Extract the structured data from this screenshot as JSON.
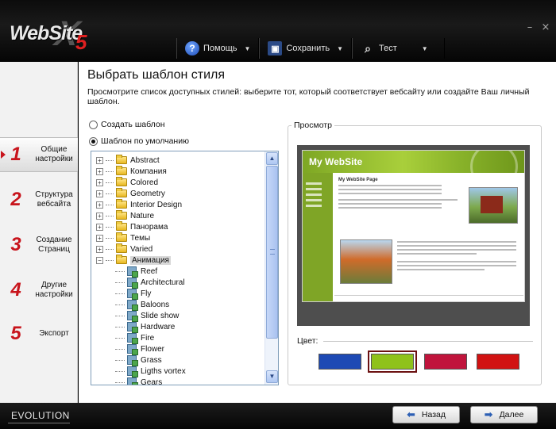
{
  "app": {
    "logo_text": "WebSite",
    "logo_x": "X",
    "logo_version": "5",
    "window_controls": [
      "–",
      "×"
    ]
  },
  "toolbar": {
    "help_label": "Помощь",
    "save_label": "Сохранить",
    "test_label": "Тест",
    "help_icon": "help-icon",
    "save_icon": "floppy-icon",
    "test_icon": "magnifier-icon"
  },
  "sidebar": {
    "items": [
      {
        "num": "1",
        "label": "Общие настройки",
        "active": true
      },
      {
        "num": "2",
        "label": "Структура вебсайта",
        "active": false
      },
      {
        "num": "3",
        "label": "Создание Страниц",
        "active": false
      },
      {
        "num": "4",
        "label": "Другие настройки",
        "active": false
      },
      {
        "num": "5",
        "label": "Экспорт",
        "active": false
      }
    ]
  },
  "main": {
    "title": "Выбрать шаблон стиля",
    "description": "Просмотрите список доступных стилей: выберите тот, который соответствует вебсайту или создайте Ваш личный шаблон.",
    "radio_create": "Создать шаблон",
    "radio_default": "Шаблон по умолчанию",
    "selected_radio": "default"
  },
  "tree": {
    "folders": [
      "Abstract",
      "Компания",
      "Colored",
      "Geometry",
      "Interior Design",
      "Nature",
      "Панорама",
      "Темы",
      "Varied",
      "Анимация"
    ],
    "selected_folder": "Анимация",
    "children": [
      "Reef",
      "Architectural",
      "Fly",
      "Baloons",
      "Slide show",
      "Hardware",
      "Fire",
      "Flower",
      "Grass",
      "Ligths vortex",
      "Gears"
    ]
  },
  "preview": {
    "legend": "Просмотр",
    "site_title": "My WebSite",
    "site_heading": "My WebSite Page",
    "color_label": "Цвет:",
    "swatches": [
      "#1d49b4",
      "#8fc21b",
      "#c0143c",
      "#d11212"
    ],
    "selected_swatch": 1
  },
  "footer": {
    "brand": "EVOLUTION",
    "back_label": "Назад",
    "next_label": "Далее"
  }
}
